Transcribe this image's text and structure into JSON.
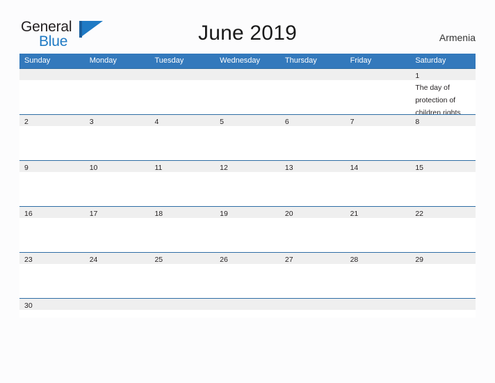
{
  "logo": {
    "word_one": "General",
    "word_two": "Blue",
    "mark": "flag-triangle"
  },
  "header": {
    "title": "June 2019",
    "country": "Armenia"
  },
  "calendar": {
    "day_headers": [
      "Sunday",
      "Monday",
      "Tuesday",
      "Wednesday",
      "Thursday",
      "Friday",
      "Saturday"
    ],
    "colors": {
      "header_blue": "#3379bc",
      "row_rule": "#2e6da4",
      "day_band": "#efefef",
      "logo_blue": "#1f7ac4",
      "page_background": "#fcfcfd"
    },
    "weeks": [
      [
        {
          "date": "",
          "event": ""
        },
        {
          "date": "",
          "event": ""
        },
        {
          "date": "",
          "event": ""
        },
        {
          "date": "",
          "event": ""
        },
        {
          "date": "",
          "event": ""
        },
        {
          "date": "",
          "event": ""
        },
        {
          "date": "1",
          "event": "The day of protection of children rights"
        }
      ],
      [
        {
          "date": "2",
          "event": ""
        },
        {
          "date": "3",
          "event": ""
        },
        {
          "date": "4",
          "event": ""
        },
        {
          "date": "5",
          "event": ""
        },
        {
          "date": "6",
          "event": ""
        },
        {
          "date": "7",
          "event": ""
        },
        {
          "date": "8",
          "event": ""
        }
      ],
      [
        {
          "date": "9",
          "event": ""
        },
        {
          "date": "10",
          "event": ""
        },
        {
          "date": "11",
          "event": ""
        },
        {
          "date": "12",
          "event": ""
        },
        {
          "date": "13",
          "event": ""
        },
        {
          "date": "14",
          "event": ""
        },
        {
          "date": "15",
          "event": ""
        }
      ],
      [
        {
          "date": "16",
          "event": ""
        },
        {
          "date": "17",
          "event": ""
        },
        {
          "date": "18",
          "event": ""
        },
        {
          "date": "19",
          "event": ""
        },
        {
          "date": "20",
          "event": ""
        },
        {
          "date": "21",
          "event": ""
        },
        {
          "date": "22",
          "event": ""
        }
      ],
      [
        {
          "date": "23",
          "event": ""
        },
        {
          "date": "24",
          "event": ""
        },
        {
          "date": "25",
          "event": ""
        },
        {
          "date": "26",
          "event": ""
        },
        {
          "date": "27",
          "event": ""
        },
        {
          "date": "28",
          "event": ""
        },
        {
          "date": "29",
          "event": ""
        }
      ],
      [
        {
          "date": "30",
          "event": ""
        },
        {
          "date": "",
          "event": ""
        },
        {
          "date": "",
          "event": ""
        },
        {
          "date": "",
          "event": ""
        },
        {
          "date": "",
          "event": ""
        },
        {
          "date": "",
          "event": ""
        },
        {
          "date": "",
          "event": ""
        }
      ]
    ]
  }
}
